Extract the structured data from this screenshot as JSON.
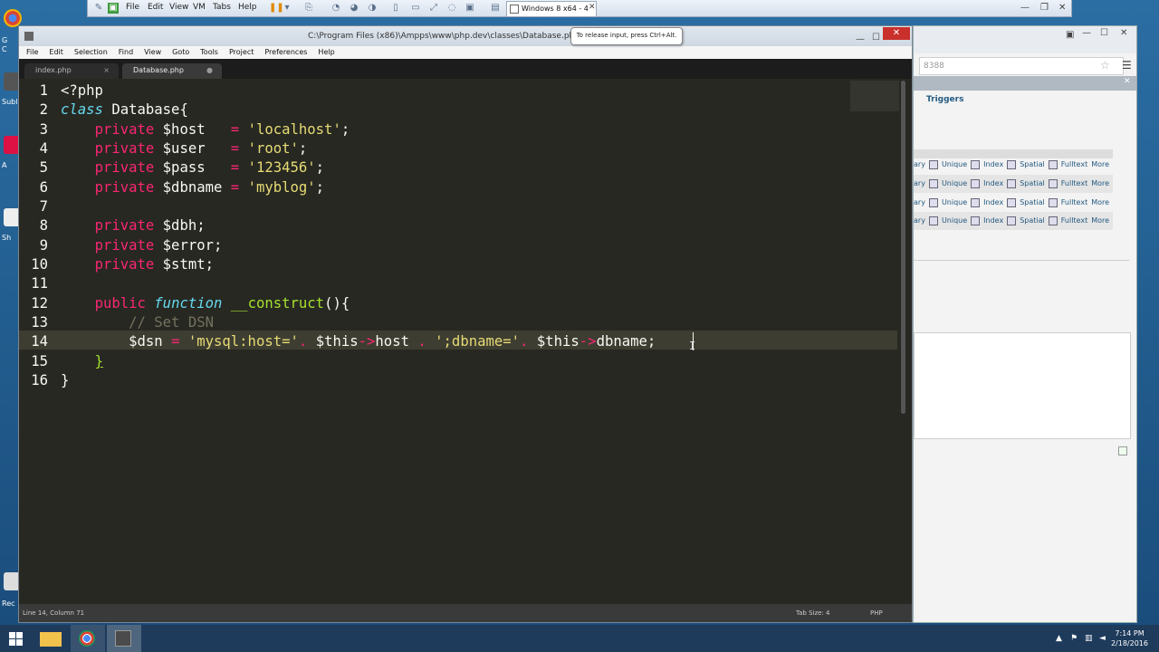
{
  "vmware": {
    "menus": [
      "File",
      "Edit",
      "View",
      "VM",
      "Tabs",
      "Help"
    ],
    "tab_label": "Windows 8 x64 - 4",
    "tooltip": "To release input, press Ctrl+Alt."
  },
  "desktop": {
    "icon_labels": [
      "G",
      "C",
      "Subl",
      "A",
      "Sh",
      "Rec"
    ]
  },
  "sublime": {
    "title": "C:\\Program Files (x86)\\Ampps\\www\\php.dev\\classes\\Database.php • - Sublim",
    "menus": [
      "File",
      "Edit",
      "Selection",
      "Find",
      "View",
      "Goto",
      "Tools",
      "Project",
      "Preferences",
      "Help"
    ],
    "tabs": [
      {
        "label": "index.php",
        "close": "×"
      },
      {
        "label": "Database.php",
        "close": "●"
      }
    ],
    "line_numbers": [
      "1",
      "2",
      "3",
      "4",
      "5",
      "6",
      "7",
      "8",
      "9",
      "10",
      "11",
      "12",
      "13",
      "14",
      "15",
      "16"
    ],
    "code": {
      "l1": "<?php",
      "l2_kw": "class",
      "l2_name": " Database{",
      "priv": "private",
      "host_var": " $host   ",
      "user_var": " $user   ",
      "pass_var": " $pass   ",
      "dbname_var": " $dbname ",
      "eq": "=",
      "host_val": "'localhost'",
      "user_val": "'root'",
      "pass_val": "'123456'",
      "dbname_val": "'myblog'",
      "semi": ";",
      "dbh": " $dbh;",
      "error": " $error;",
      "stmt": " $stmt;",
      "public": "public",
      "function": "function",
      "construct": "__construct",
      "paren": "(){",
      "comment": "// Set DSN",
      "dsn_var": "$dsn",
      "dsn_str1": "'mysql:host='",
      "dot": ".",
      "this": "$this",
      "arrow": "->",
      "host": "host",
      "dsn_str2": "';dbname='",
      "dbname": "dbname",
      "close_brace": "}"
    },
    "status": {
      "position": "Line 14, Column 71",
      "tab_size": "Tab Size: 4",
      "syntax": "PHP"
    }
  },
  "browser": {
    "address": "8388",
    "triggers": "Triggers",
    "row_actions": [
      "ary",
      "Unique",
      "Index",
      "Spatial",
      "Fulltext",
      "More"
    ],
    "close": "✕"
  },
  "taskbar": {
    "time": "7:14 PM",
    "date": "2/18/2016"
  },
  "colors": {
    "editor_bg": "#272822",
    "keyword": "#f92672",
    "string": "#e6db74",
    "function": "#a6e22e",
    "comment": "#75715e"
  }
}
